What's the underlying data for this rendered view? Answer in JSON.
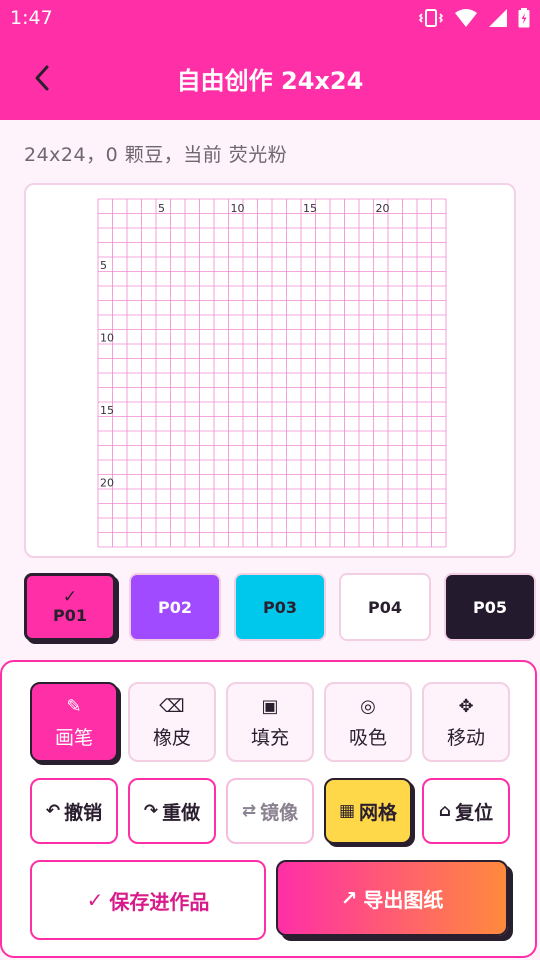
{
  "status": {
    "time": "1:47"
  },
  "header": {
    "title": "自由创作 24x24"
  },
  "summary": "24x24，0 颗豆，当前 荧光粉",
  "grid": {
    "cols": 24,
    "rows": 24,
    "col_labels": [
      "5",
      "10",
      "15",
      "20"
    ],
    "row_labels": [
      "5",
      "10",
      "15",
      "20"
    ],
    "line_color": "#f08ad0"
  },
  "palette": [
    {
      "label": "P01",
      "check": "✓",
      "color": "#ff2fa7",
      "text_color": "#2a1f2e",
      "selected": true
    },
    {
      "label": "P02",
      "color": "#a04bff",
      "text_color": "#ffffff",
      "selected": false
    },
    {
      "label": "P03",
      "color": "#00c8ec",
      "text_color": "#2a1f2e",
      "selected": false
    },
    {
      "label": "P04",
      "color": "#ffffff",
      "text_color": "#2a1f2e",
      "selected": false
    },
    {
      "label": "P05",
      "color": "#241a2e",
      "text_color": "#ffffff",
      "selected": false
    }
  ],
  "tools": [
    {
      "icon": "✎",
      "label": "画笔",
      "icon_name": "pencil-icon",
      "active": true
    },
    {
      "icon": "⌫",
      "label": "橡皮",
      "icon_name": "eraser-icon",
      "active": false
    },
    {
      "icon": "▣",
      "label": "填充",
      "icon_name": "fill-icon",
      "active": false
    },
    {
      "icon": "◎",
      "label": "吸色",
      "icon_name": "eyedropper-icon",
      "active": false
    },
    {
      "icon": "✥",
      "label": "移动",
      "icon_name": "move-icon",
      "active": false
    }
  ],
  "actions": [
    {
      "icon": "↶",
      "label": "撤销",
      "icon_name": "undo-icon",
      "state": "normal"
    },
    {
      "icon": "↷",
      "label": "重做",
      "icon_name": "redo-icon",
      "state": "normal"
    },
    {
      "icon": "⇄",
      "label": "镜像",
      "icon_name": "mirror-icon",
      "state": "disabled"
    },
    {
      "icon": "▦",
      "label": "网格",
      "icon_name": "grid-icon",
      "state": "active"
    },
    {
      "icon": "⌂",
      "label": "复位",
      "icon_name": "home-icon",
      "state": "normal"
    }
  ],
  "save": {
    "icon": "✓",
    "label": "保存进作品"
  },
  "export": {
    "icon": "↗",
    "label": "导出图纸"
  }
}
